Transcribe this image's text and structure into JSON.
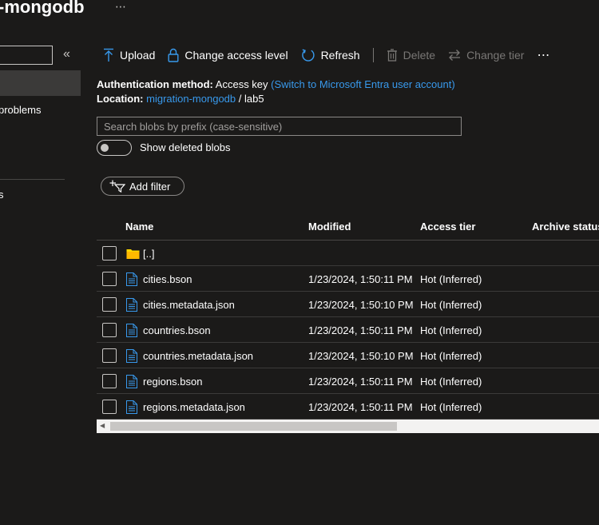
{
  "header": {
    "title": "-mongodb",
    "more": "⋯"
  },
  "nav": {
    "collapse_glyph": "«",
    "item_problems": "problems",
    "item_s": "s"
  },
  "toolbar": {
    "upload": "Upload",
    "change_access": "Change access level",
    "refresh": "Refresh",
    "delete": "Delete",
    "change_tier": "Change tier",
    "more": "⋯"
  },
  "info": {
    "auth_label": "Authentication method:",
    "auth_value": "Access key",
    "auth_link": "(Switch to Microsoft Entra user account)",
    "location_label": "Location:",
    "location_container": "migration-mongodb",
    "location_sep": "/",
    "location_folder": "lab5"
  },
  "search": {
    "placeholder": "Search blobs by prefix (case-sensitive)"
  },
  "toggle": {
    "label": "Show deleted blobs"
  },
  "filter": {
    "label": "Add filter"
  },
  "table": {
    "headers": {
      "name": "Name",
      "modified": "Modified",
      "tier": "Access tier",
      "archive": "Archive status"
    },
    "parent_row": {
      "name": "[..]"
    },
    "rows": [
      {
        "name": "cities.bson",
        "modified": "1/23/2024, 1:50:11 PM",
        "tier": "Hot (Inferred)"
      },
      {
        "name": "cities.metadata.json",
        "modified": "1/23/2024, 1:50:10 PM",
        "tier": "Hot (Inferred)"
      },
      {
        "name": "countries.bson",
        "modified": "1/23/2024, 1:50:11 PM",
        "tier": "Hot (Inferred)"
      },
      {
        "name": "countries.metadata.json",
        "modified": "1/23/2024, 1:50:10 PM",
        "tier": "Hot (Inferred)"
      },
      {
        "name": "regions.bson",
        "modified": "1/23/2024, 1:50:11 PM",
        "tier": "Hot (Inferred)"
      },
      {
        "name": "regions.metadata.json",
        "modified": "1/23/2024, 1:50:11 PM",
        "tier": "Hot (Inferred)"
      }
    ]
  },
  "colors": {
    "background": "#1b1a19",
    "accent_link": "#3899ec",
    "toolbar_icon": "#3899ec",
    "folder": "#ffd800",
    "file_icon": "#3899ec"
  }
}
